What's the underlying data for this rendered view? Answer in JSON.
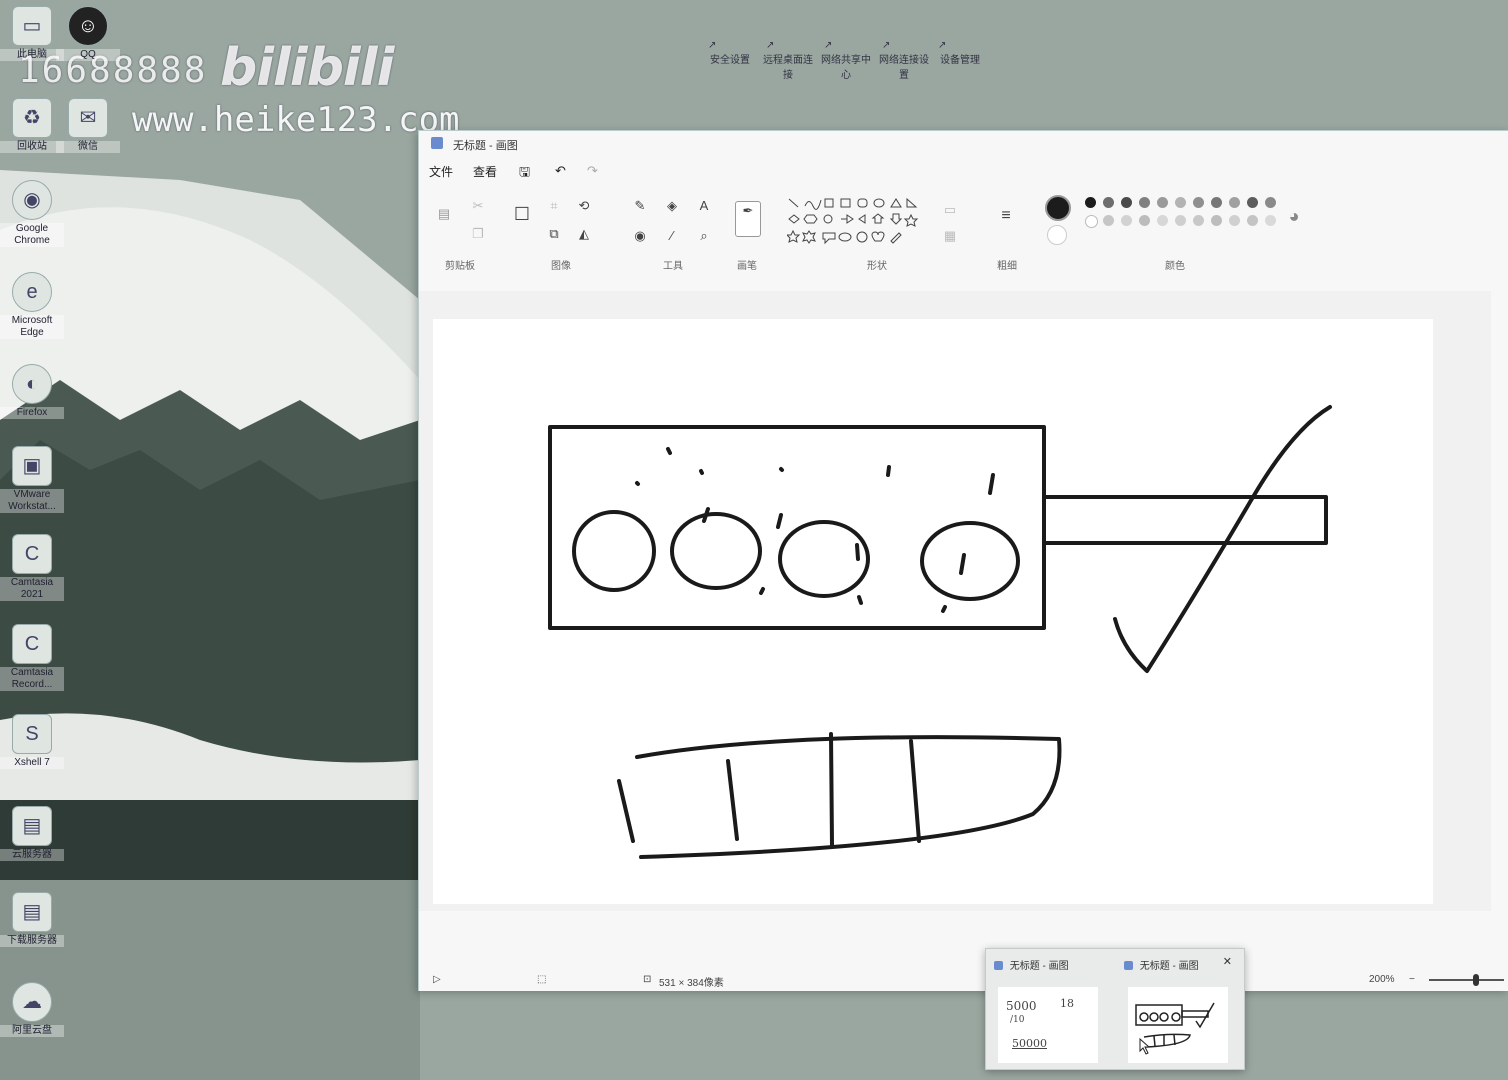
{
  "watermark": {
    "number": "16688888",
    "brand": "bilibili",
    "url": "www.heike123.com"
  },
  "desktop_icons": [
    {
      "label": "此电脑",
      "icon": "computer-icon"
    },
    {
      "label": "回收站",
      "icon": "recycle-bin-icon"
    },
    {
      "label": "微信",
      "icon": "wechat-icon"
    },
    {
      "label": "Google Chrome",
      "icon": "chrome-icon"
    },
    {
      "label": "Microsoft Edge",
      "icon": "edge-icon"
    },
    {
      "label": "Firefox",
      "icon": "firefox-icon"
    },
    {
      "label": "VMware Workstat...",
      "icon": "vmware-icon"
    },
    {
      "label": "Camtasia 2021",
      "icon": "camtasia-icon"
    },
    {
      "label": "Camtasia Record...",
      "icon": "camtasia-recorder-icon"
    },
    {
      "label": "Xshell 7",
      "icon": "xshell-icon"
    },
    {
      "label": "云服务器",
      "icon": "folder-icon"
    },
    {
      "label": "下载服务器",
      "icon": "folder-icon"
    },
    {
      "label": "阿里云盘",
      "icon": "cloud-drive-icon"
    }
  ],
  "qq_label": "QQ",
  "top_shortcuts": [
    "安全设置",
    "远程桌面连接",
    "网络共享中心",
    "网络连接设置",
    "设备管理"
  ],
  "paint": {
    "title": "无标题 - 画图",
    "menu": {
      "file": "文件",
      "view": "查看"
    },
    "groups": {
      "image_left": "剪贴板",
      "image": "图像",
      "tools": "工具",
      "brush": "画笔",
      "shapes": "形状",
      "size": "粗细",
      "colors": "颜色"
    },
    "status": {
      "dimensions": "531 × 384像素",
      "zoom": "200%"
    }
  },
  "colors": {
    "palette_row1": [
      "#1c1c1c",
      "#6d6d6d",
      "#4a4a4a",
      "#808080",
      "#9a9a9a",
      "#b3b3b3",
      "#8f8f8f",
      "#777777",
      "#a0a0a0",
      "#5d5d5d",
      "#8a8a8a"
    ],
    "palette_row2": [
      "#ffffff",
      "#c6c6c6",
      "#d2d2d2",
      "#bcbcbc",
      "#d7d7d7",
      "#cfcfcf",
      "#c8c8c8",
      "#bdbdbd",
      "#d0d0d0",
      "#c4c4c4",
      "#d9d9d9"
    ],
    "active_color": "#1c1c1c"
  },
  "thumbnails": [
    {
      "title": "无标题 - 画图"
    },
    {
      "title": "无标题 - 画图"
    }
  ],
  "thumb_notes": [
    "5000",
    "18",
    "/10",
    "50000"
  ]
}
